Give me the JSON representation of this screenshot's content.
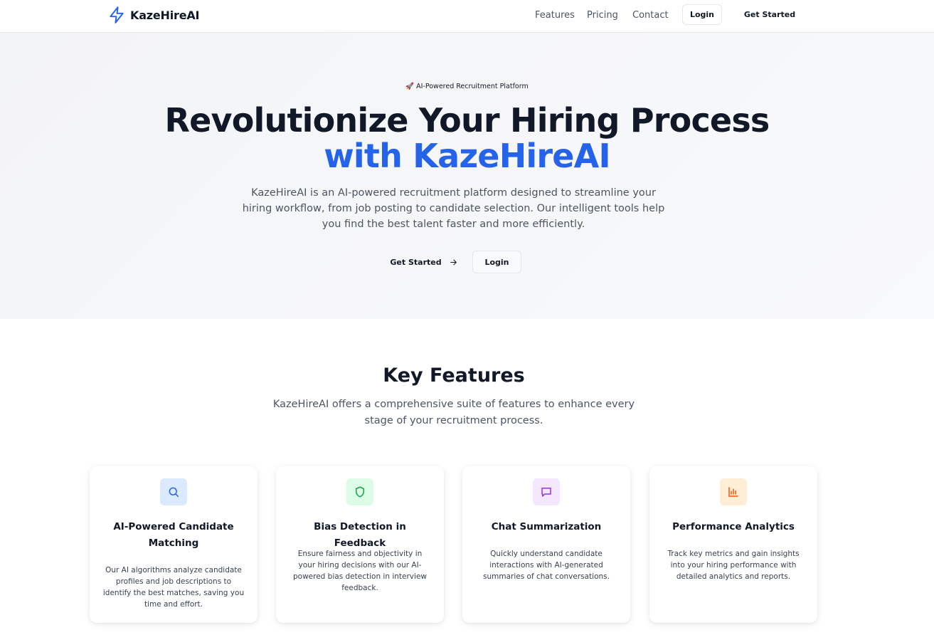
{
  "nav": {
    "brand": "KazeHireAI",
    "links": [
      "Features",
      "Pricing",
      "Contact"
    ],
    "login_label": "Login",
    "get_started_label": "Get Started"
  },
  "hero": {
    "badge": "🚀 AI-Powered Recruitment Platform",
    "title_line1": "Revolutionize Your Hiring Process",
    "title_line2": "with KazeHireAI",
    "description": "KazeHireAI is an AI-powered recruitment platform designed to streamline your hiring workflow, from job posting to candidate selection. Our intelligent tools help you find the best talent faster and more efficiently.",
    "get_started_label": "Get Started",
    "login_label": "Login"
  },
  "features": {
    "title": "Key Features",
    "description": "KazeHireAI offers a comprehensive suite of features to enhance every stage of your recruitment process.",
    "cards": [
      {
        "icon": "search-icon",
        "title": "AI-Powered Candidate Matching",
        "description": "Our AI algorithms analyze candidate profiles and job descriptions to identify the best matches, saving you time and effort.",
        "icon_bg": "#dbeafe",
        "icon_color": "#2563eb"
      },
      {
        "icon": "shield-icon",
        "title": "Bias Detection in Feedback",
        "description": "Ensure fairness and objectivity in your hiring decisions with our AI-powered bias detection in interview feedback.",
        "icon_bg": "#dcfce7",
        "icon_color": "#16a34a"
      },
      {
        "icon": "message-square-icon",
        "title": "Chat Summarization",
        "description": "Quickly understand candidate interactions with AI-generated summaries of chat conversations.",
        "icon_bg": "#f3e8ff",
        "icon_color": "#9333ea"
      },
      {
        "icon": "bar-chart-icon",
        "title": "Performance Analytics",
        "description": "Track key metrics and gain insights into your hiring performance with detailed analytics and reports.",
        "icon_bg": "#ffedd5",
        "icon_color": "#ea580c"
      }
    ]
  },
  "colors": {
    "accent": "#2563eb",
    "text_dark": "#111827",
    "text_muted": "#4b5563"
  }
}
